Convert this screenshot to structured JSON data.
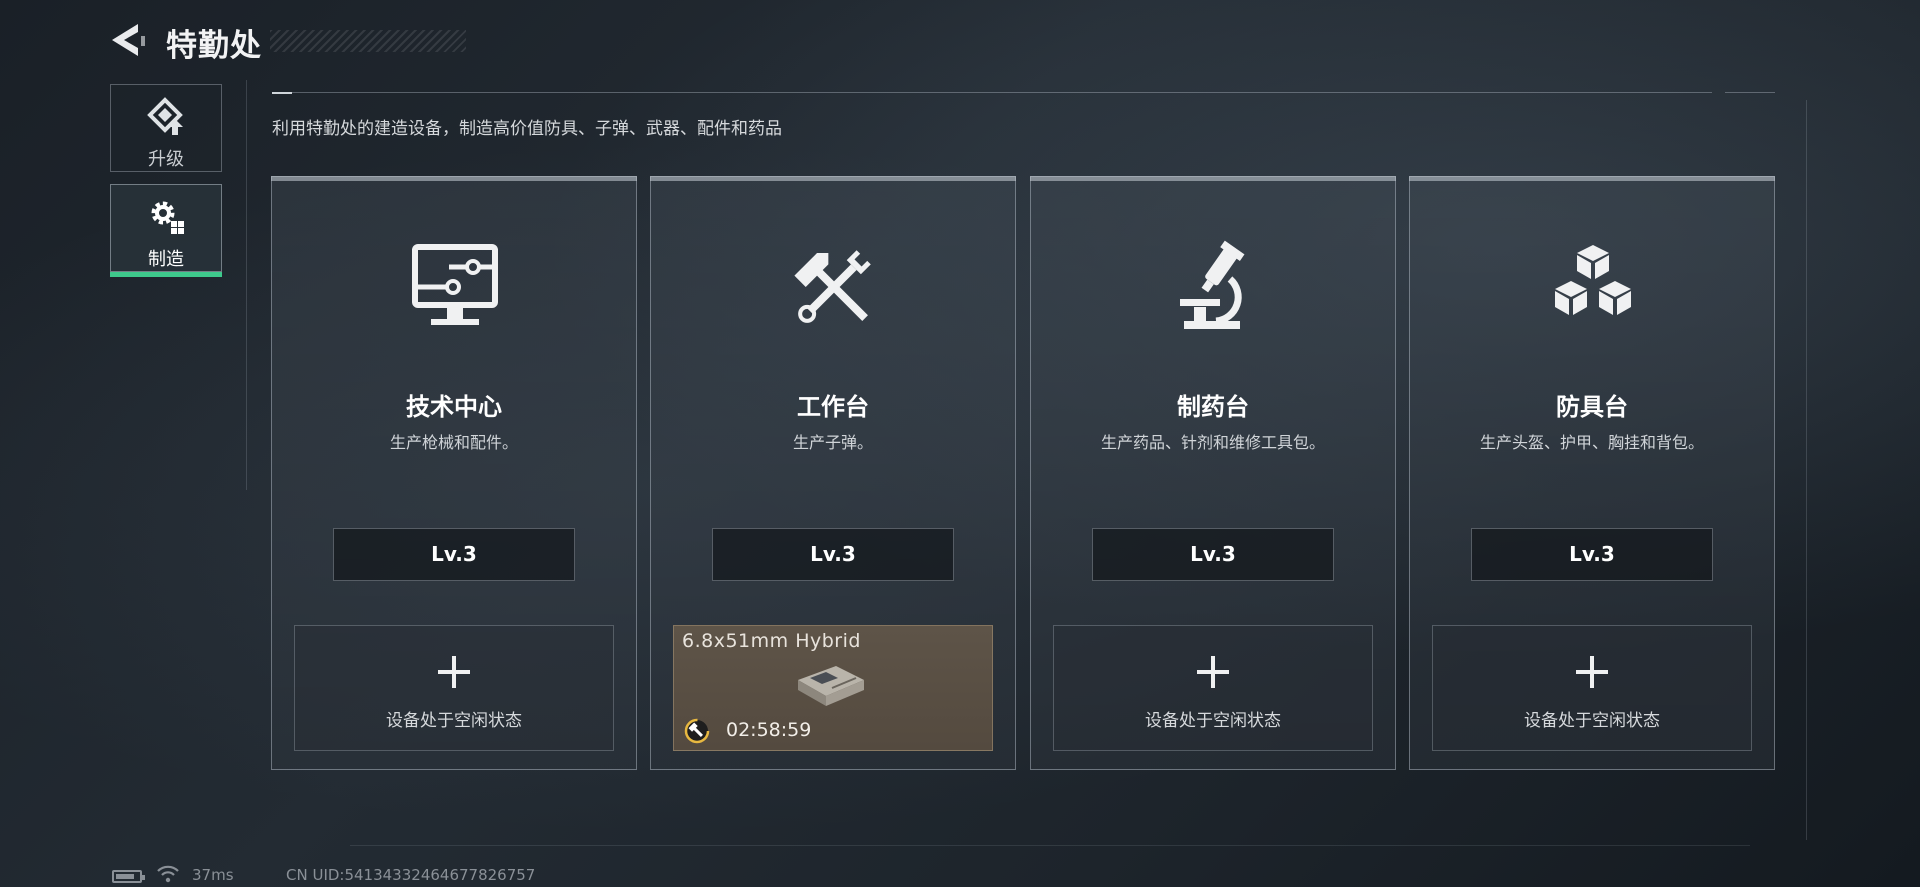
{
  "header": {
    "title": "特勤处",
    "back_icon": "back-arrow-icon"
  },
  "nav": {
    "tabs": [
      {
        "label": "升级",
        "icon": "upgrade-icon",
        "active": false
      },
      {
        "label": "制造",
        "icon": "manufacture-gears-icon",
        "active": true
      }
    ]
  },
  "subtitle": "利用特勤处的建造设备，制造高价值防具、子弹、武器、配件和药品",
  "cards": [
    {
      "title": "技术中心",
      "desc": "生产枪械和配件。",
      "level": "Lv.3",
      "icon": "monitor-circuit-icon",
      "slot": {
        "state": "idle",
        "idle_text": "设备处于空闲状态",
        "icon": "plus-icon"
      }
    },
    {
      "title": "工作台",
      "desc": "生产子弹。",
      "level": "Lv.3",
      "icon": "hammer-wrench-icon",
      "slot": {
        "state": "active",
        "item_name": "6.8x51mm Hybrid",
        "timer": "02:58:59",
        "icon": "ammo-box-icon",
        "timer_icon": "wrench-timer-icon"
      }
    },
    {
      "title": "制药台",
      "desc": "生产药品、针剂和维修工具包。",
      "level": "Lv.3",
      "icon": "microscope-icon",
      "slot": {
        "state": "idle",
        "idle_text": "设备处于空闲状态",
        "icon": "plus-icon"
      }
    },
    {
      "title": "防具台",
      "desc": "生产头盔、护甲、胸挂和背包。",
      "level": "Lv.3",
      "icon": "stacked-boxes-icon",
      "slot": {
        "state": "idle",
        "idle_text": "设备处于空闲状态",
        "icon": "plus-icon"
      }
    }
  ],
  "status_bar": {
    "ping": "37ms",
    "uid": "CN UID:541343324646778267​57",
    "battery_level": 0.8
  },
  "colors": {
    "accent_green": "#3ec98c",
    "active_slot_bg": "#5e5448",
    "timer_ring": "#e8b840"
  }
}
